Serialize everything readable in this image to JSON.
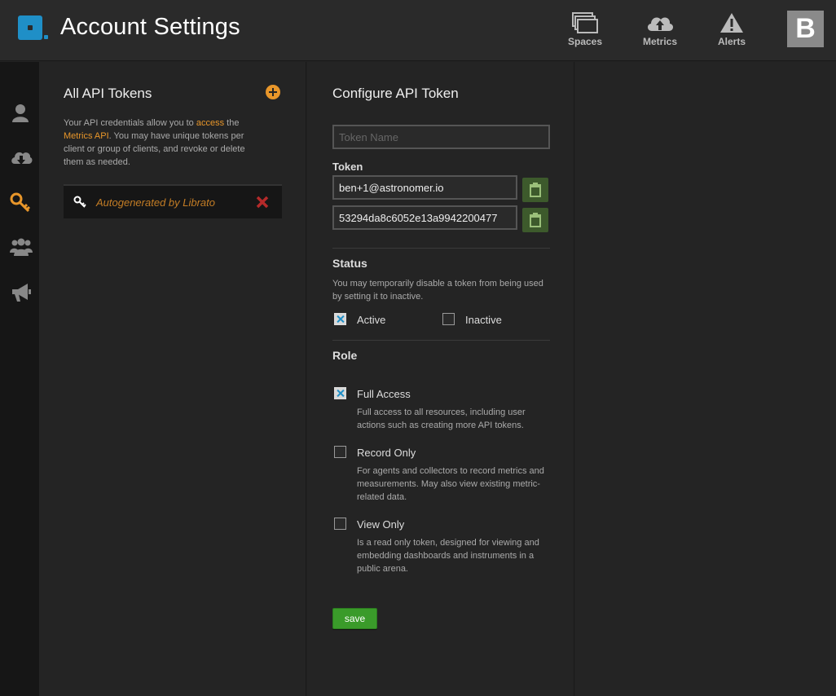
{
  "header": {
    "app_title": "Account Settings",
    "nav": [
      {
        "label": "Spaces",
        "icon": "spaces-icon"
      },
      {
        "label": "Metrics",
        "icon": "cloud-upload-icon"
      },
      {
        "label": "Alerts",
        "icon": "alert-icon"
      }
    ],
    "avatar_letter": "B"
  },
  "sidebar": {
    "items": [
      {
        "icon": "user-icon",
        "active": false
      },
      {
        "icon": "cloud-download-icon",
        "active": false
      },
      {
        "icon": "key-icon",
        "active": true
      },
      {
        "icon": "group-icon",
        "active": false
      },
      {
        "icon": "megaphone-icon",
        "active": false
      }
    ]
  },
  "tokens_panel": {
    "title": "All API Tokens",
    "intro_part1": "Your API credentials allow you to ",
    "intro_link1": "access",
    "intro_part2": " the ",
    "intro_link2": "Metrics API",
    "intro_part3": ". You may have unique tokens per client or group of clients, and revoke or delete them as needed.",
    "tokens": [
      {
        "label": "Autogenerated by Librato"
      }
    ]
  },
  "config_panel": {
    "title": "Configure API Token",
    "token_name_placeholder": "Token Name",
    "token_label": "Token",
    "token_user": "ben+1@astronomer.io",
    "token_value": "53294da8c6052e13a9942200477",
    "status": {
      "title": "Status",
      "help": "You may temporarily disable a token from being used by setting it to inactive.",
      "active_label": "Active",
      "inactive_label": "Inactive",
      "selected": "Active"
    },
    "role": {
      "title": "Role",
      "options": [
        {
          "label": "Full Access",
          "desc": "Full access to all resources, including user actions such as creating more API tokens.",
          "checked": true
        },
        {
          "label": "Record Only",
          "desc": "For agents and collectors to record metrics and measurements. May also view existing metric-related data.",
          "checked": false
        },
        {
          "label": "View Only",
          "desc": "Is a read only token, designed for viewing and embedding dashboards and instruments in a public arena.",
          "checked": false
        }
      ]
    },
    "save_label": "save"
  },
  "colors": {
    "accent_orange": "#e8962a",
    "brand_blue": "#1f8fc7",
    "save_green": "#3a9b2a",
    "delete_red": "#b52a2a"
  }
}
